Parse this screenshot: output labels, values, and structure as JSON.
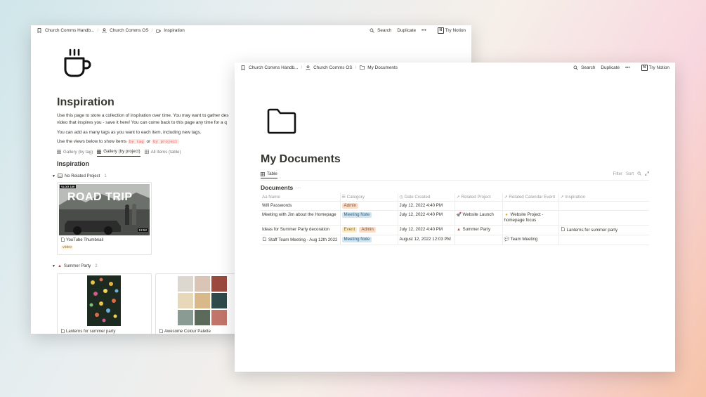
{
  "colors": {
    "accent": "#37352f",
    "admin": "#fadec9",
    "meeting_note": "#d3e5ef",
    "event": "#fdecc8"
  },
  "back_window": {
    "breadcrumbs": [
      "Church Comms Handb...",
      "Church Comms OS",
      "Inspiration"
    ],
    "actions": {
      "search": "Search",
      "duplicate": "Duplicate",
      "more": "•••",
      "try": "Try Notion"
    },
    "page_icon": "coffee-cup-icon",
    "title": "Inspiration",
    "para1_line1": "Use this page to store a collection of inspiration over time. You may want to gather des",
    "para1_line2": "video that inspires you - save it here! You can come back to this page any time for a q",
    "para2": "You can add as many tags as you want to each item, including new tags.",
    "para3_prefix": "Use the views below to show items",
    "para3_tag1": "by tag",
    "para3_or": "or",
    "para3_tag2": "by project",
    "tabs": [
      "Gallery (by tag)",
      "Gallery (by project)",
      "All Items (table)"
    ],
    "view_title": "Inspiration",
    "group1": {
      "label": "No Related Project",
      "count": "1"
    },
    "card1": {
      "badge": "VLOG 189",
      "overlay": "ROAD TRIP",
      "duration": "13:52",
      "label": "YouTube Thumbnail",
      "tag": "video"
    },
    "group2": {
      "label": "Summer Party",
      "count": "2"
    },
    "card2": {
      "label": "Lanterns for summer party"
    },
    "card3": {
      "label": "Awesome Colour Palette"
    }
  },
  "front_window": {
    "breadcrumbs": [
      "Church Comms Handb...",
      "Church Comms OS",
      "My Documents"
    ],
    "actions": {
      "search": "Search",
      "duplicate": "Duplicate",
      "more": "•••",
      "try": "Try Notion"
    },
    "page_icon": "folder-icon",
    "title": "My Documents",
    "tab": "Table",
    "tools": {
      "filter": "Filter",
      "sort": "Sort"
    },
    "db_title": "Documents",
    "db_more": "···",
    "columns": [
      "Name",
      "Category",
      "Date Created",
      "Related Project",
      "Related Calendar Event",
      "Inspiration"
    ],
    "rows": [
      {
        "name": "Wifi Passwords",
        "cat1": "Admin",
        "cat2": "",
        "date": "July 12, 2022 4:40 PM",
        "project": "",
        "event": "",
        "inspiration": ""
      },
      {
        "name": "Meeting with Jim about the Homepage",
        "cat1": "Meeting Note",
        "cat2": "",
        "date": "July 12, 2022 4:40 PM",
        "project": "Website Launch",
        "event": "Website Project - homepage focus",
        "inspiration": ""
      },
      {
        "name": "Ideas for Summer Party decoration",
        "cat1": "Event",
        "cat2": "Admin",
        "date": "July 12, 2022 4:40 PM",
        "project": "Summer Party",
        "event": "",
        "inspiration": "Lanterns for summer party"
      },
      {
        "name": "Staff Team Meeting - Aug 12th 2022",
        "cat1": "Meeting Note",
        "cat2": "",
        "date": "August 12, 2022 12:03 PM",
        "project": "",
        "event": "Team Meeting",
        "inspiration": ""
      }
    ]
  }
}
